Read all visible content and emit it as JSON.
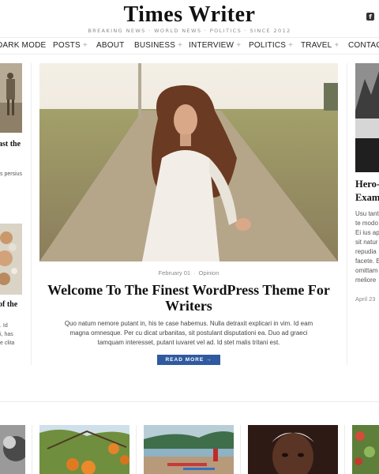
{
  "site": {
    "title": "Times Writer",
    "tagline": "BREAKING NEWS · WORLD NEWS · POLITICS · SINCE 2012",
    "social_icon": "facebook-icon",
    "social_glyph": "f"
  },
  "nav": {
    "items": [
      {
        "label": "DARK MODE",
        "has_submenu": false
      },
      {
        "label": "POSTS",
        "has_submenu": true
      },
      {
        "label": "ABOUT",
        "has_submenu": false
      },
      {
        "label": "BUSINESS",
        "has_submenu": true
      },
      {
        "label": "INTERVIEW",
        "has_submenu": true
      },
      {
        "label": "POLITICS",
        "has_submenu": true
      },
      {
        "label": "TRAVEL",
        "has_submenu": true
      },
      {
        "label": "CONTACT",
        "has_submenu": false
      }
    ],
    "submenu_glyph": "+"
  },
  "left": {
    "card1_title": "ast the",
    "card1_text": "s persius",
    "card2_title": "of the",
    "card2_text": [
      ". Id",
      "i, has",
      "e clita"
    ]
  },
  "hero": {
    "date": "February 01",
    "category": "Opinion",
    "separator": "·",
    "title": "Welcome To The Finest WordPress Theme For Writers",
    "excerpt": "Quo natum nemore putant in, his te case habemus. Nulla detraxit explicari in vim. Id eam magna omnesque. Per cu dicat urbanitas, sit postulant disputationi ea. Duo ad graeci tamquam interesset, putant iuvaret vel ad. Id stet malis tritani est.",
    "button_label": "READ MORE →"
  },
  "right": {
    "title_lines": [
      "Hero-",
      "Exam"
    ],
    "text_lines": [
      "Usu tant",
      "te modo",
      "Ei ius ap",
      "sit natur",
      "repudia",
      "facete. E",
      "omittam",
      "meliore"
    ],
    "date": "April 23"
  },
  "colors": {
    "accent": "#2f5aa0",
    "divider": "#ececec"
  }
}
